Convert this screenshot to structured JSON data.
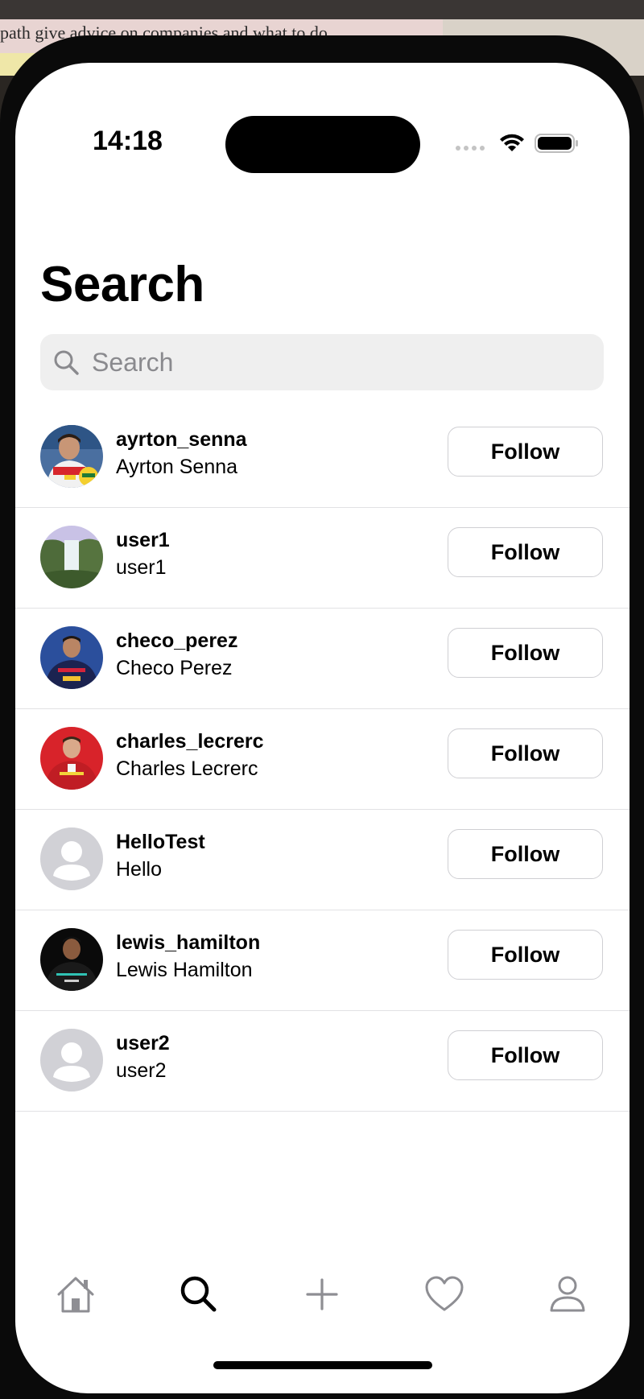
{
  "background": {
    "doc_text": "path give advice on companies and what to do"
  },
  "status_bar": {
    "time": "14:18"
  },
  "page": {
    "title": "Search"
  },
  "search": {
    "placeholder": "Search",
    "value": ""
  },
  "users": [
    {
      "username": "ayrton_senna",
      "full_name": "Ayrton Senna",
      "avatar": "photo-senna",
      "action": "Follow"
    },
    {
      "username": "user1",
      "full_name": "user1",
      "avatar": "photo-waterfall",
      "action": "Follow"
    },
    {
      "username": "checo_perez",
      "full_name": "Checo Perez",
      "avatar": "photo-perez",
      "action": "Follow"
    },
    {
      "username": "charles_lecrerc",
      "full_name": "Charles Lecrerc",
      "avatar": "photo-leclerc",
      "action": "Follow"
    },
    {
      "username": "HelloTest",
      "full_name": "Hello",
      "avatar": "placeholder-person-icon",
      "action": "Follow"
    },
    {
      "username": "lewis_hamilton",
      "full_name": "Lewis Hamilton",
      "avatar": "photo-hamilton",
      "action": "Follow"
    },
    {
      "username": "user2",
      "full_name": "user2",
      "avatar": "placeholder-person-icon",
      "action": "Follow"
    }
  ],
  "tab_bar": {
    "tabs": [
      {
        "icon": "home-icon",
        "active": false
      },
      {
        "icon": "search-icon",
        "active": true
      },
      {
        "icon": "plus-icon",
        "active": false
      },
      {
        "icon": "heart-icon",
        "active": false
      },
      {
        "icon": "profile-icon",
        "active": false
      }
    ]
  },
  "colors": {
    "background": "#ffffff",
    "search_field": "#efefef",
    "placeholder_text": "#8a8a8e",
    "separator": "#e2e2e4",
    "inactive_tab": "#8e8e93",
    "active_tab": "#000000"
  }
}
